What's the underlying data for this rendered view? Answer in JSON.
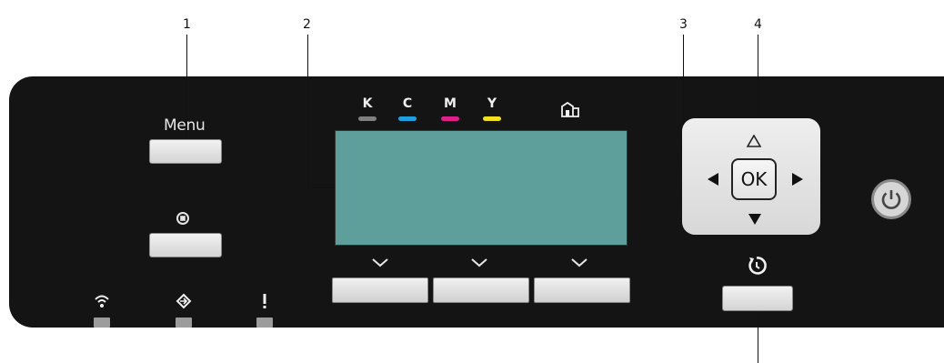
{
  "callouts": [
    "1",
    "2",
    "3",
    "4"
  ],
  "buttons": {
    "menu_label": "Menu",
    "ok_label": "OK"
  },
  "toner": [
    {
      "label": "K",
      "color": "#808080"
    },
    {
      "label": "C",
      "color": "#1f9fe0"
    },
    {
      "label": "M",
      "color": "#e0208a"
    },
    {
      "label": "Y",
      "color": "#f0e020"
    }
  ],
  "icons": {
    "stop": "stop-icon",
    "wifi": "wifi-icon",
    "data": "data-in-icon",
    "alert": "alert-icon",
    "home": "home-icon",
    "reset": "reset-icon",
    "power": "power-icon"
  },
  "colors": {
    "panel": "#141414",
    "lcd": "#5e9e9b",
    "key_face": "#e4e4e4"
  }
}
